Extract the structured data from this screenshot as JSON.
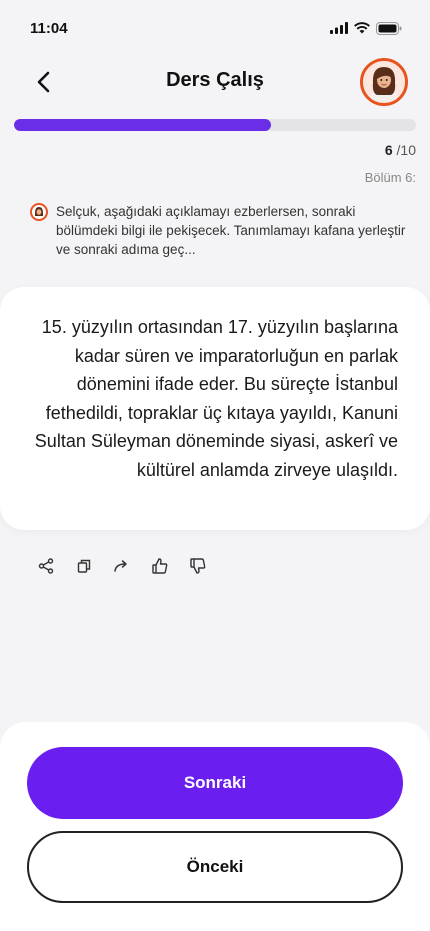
{
  "status": {
    "time": "11:04"
  },
  "header": {
    "title": "Ders Çalış"
  },
  "progress": {
    "fraction": 0.64,
    "current": "6",
    "total": "/10"
  },
  "section": {
    "label": "Bölüm 6:"
  },
  "instruction": {
    "text": "Selçuk, aşağıdaki açıklamayı ezberlersen, sonraki bölümdeki bilgi ile pekişecek. Tanımlamayı kafana yerleştir ve sonraki adıma geç..."
  },
  "card": {
    "text": "15. yüzyılın ortasından 17. yüzyılın başlarına kadar süren ve imparatorluğun en parlak dönemini ifade eder. Bu süreçte İstanbul fethedildi, topraklar üç kıtaya yayıldı, Kanuni Sultan Süleyman döneminde siyasi, askerî ve kültürel anlamda zirveye ulaşıldı."
  },
  "actions": [
    "share-icon",
    "copy-icon",
    "forward-icon",
    "thumbs-up-icon",
    "thumbs-down-icon"
  ],
  "buttons": {
    "next": "Sonraki",
    "prev": "Önceki"
  },
  "colors": {
    "accent": "#6a1ff0",
    "avatar_ring": "#e8531f",
    "progress_track": "#e3e3e8"
  }
}
